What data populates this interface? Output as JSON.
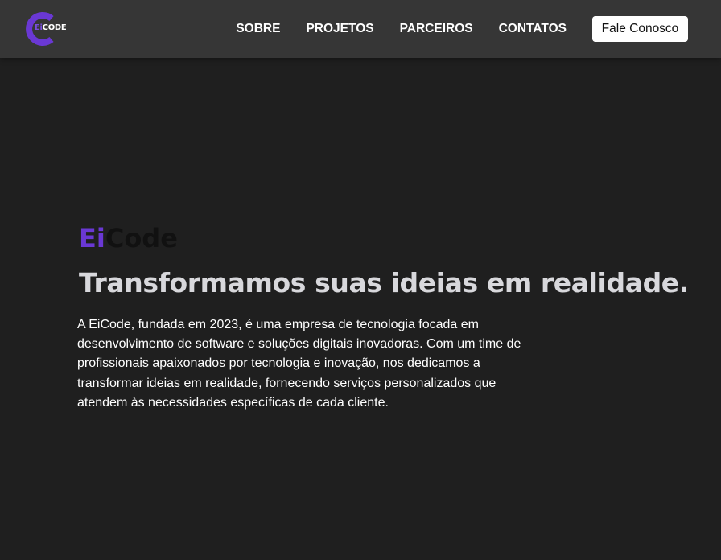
{
  "navbar": {
    "logo": {
      "prefix": "Ei",
      "suffix": "CODE",
      "brand_color": "#6a38d4"
    },
    "links": [
      {
        "label": "SOBRE"
      },
      {
        "label": "PROJETOS"
      },
      {
        "label": "PARCEIROS"
      },
      {
        "label": "CONTATOS"
      }
    ],
    "cta_label": "Fale Conosco"
  },
  "hero": {
    "brand_prefix": "Ei",
    "brand_suffix": "Code",
    "headline": "Transformamos suas ideias em realidade.",
    "description": "A EiCode, fundada em 2023, é uma empresa de tecnologia focada em desenvolvimento de software e soluções digitais inovadoras. Com um time de profissionais apaixonados por tecnologia e inovação, nos dedicamos a transformar ideias em realidade, fornecendo serviços personalizados que atendem às necessidades específicas de cada cliente."
  },
  "colors": {
    "background": "#1f1f1f",
    "navbar": "#363636",
    "accent": "#6a38d4",
    "headline": "#d8d8dc"
  }
}
